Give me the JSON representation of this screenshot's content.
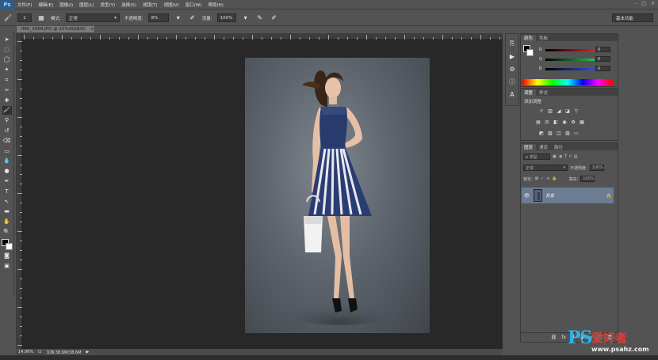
{
  "app": {
    "logo": "Ps"
  },
  "menu": [
    "文件(F)",
    "编辑(E)",
    "图像(I)",
    "图层(L)",
    "类型(Y)",
    "选择(S)",
    "滤镜(T)",
    "视图(V)",
    "窗口(W)",
    "帮助(H)"
  ],
  "window_controls": [
    "–",
    "□",
    "×"
  ],
  "options": {
    "brush_size": "1",
    "mode_label": "模式:",
    "mode_value": "正常",
    "opacity_label": "不透明度:",
    "opacity_value": "8%",
    "flow_label": "流量:",
    "flow_value": "100%",
    "workspace": "基本功能"
  },
  "document": {
    "tab_title": "IMG_3968.JPG @ 15%(RGB/8)",
    "tab_close": "×",
    "zoom": "14.99%",
    "doc_info": "文档:38.6M/38.6M"
  },
  "panels": {
    "color": {
      "tabs": [
        "颜色",
        "色板"
      ],
      "channels": [
        {
          "name": "R",
          "value": "0",
          "color": "#e0202a"
        },
        {
          "name": "G",
          "value": "0",
          "color": "#23c447"
        },
        {
          "name": "B",
          "value": "0",
          "color": "#2a4fe0"
        }
      ]
    },
    "adjustments": {
      "tabs": [
        "调整",
        "样式"
      ],
      "title": "添加调整"
    },
    "layers": {
      "tabs": [
        "图层",
        "通道",
        "路径"
      ],
      "filter_label": "ρ 类型",
      "blend_mode": "正常",
      "opacity_label": "不透明度:",
      "opacity_value": "100%",
      "lock_label": "锁定:",
      "fill_label": "填充:",
      "fill_value": "100%",
      "layer_name": "背景"
    }
  },
  "watermark": {
    "brand": "PS",
    "chinese": "爱好者",
    "url": "www.psahz.com"
  },
  "colors": {
    "selection_blue": "#6b7c93",
    "ps_logo_bg": "#2c5d88"
  }
}
